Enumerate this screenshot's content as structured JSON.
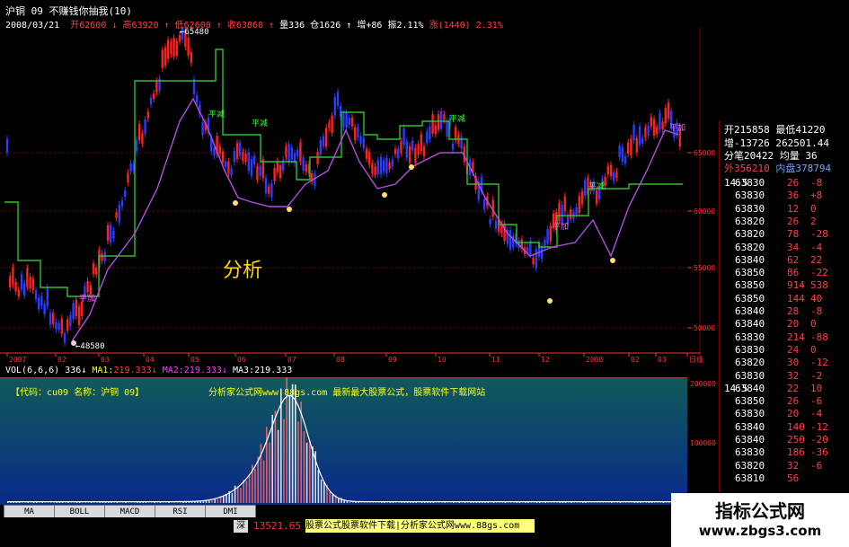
{
  "window": {
    "title": "沪铜 09 不赚钱你抽我(10)"
  },
  "info": {
    "date": "2008/03/21",
    "open_label": "开",
    "open": "62600",
    "high_label": "高",
    "high": "63920",
    "low_label": "低",
    "low": "62600",
    "close_label": "收",
    "close": "63860",
    "volume_label": "量",
    "volume": "336",
    "oi_label": "仓",
    "oi": "1626",
    "add_label": "增",
    "add": "+86",
    "swing_label": "振",
    "swing": "2.11%",
    "rise_label": "涨",
    "rise": "(1440)",
    "rise_pct": "2.31%"
  },
  "price_chart": {
    "high_marker": "65480",
    "low_marker": "48580",
    "big_text": "分析",
    "y_ticks": [
      "65000",
      "60000",
      "55000",
      "50000"
    ],
    "x_ticks": [
      "2007",
      "02",
      "03",
      "04",
      "05",
      "06",
      "07",
      "08",
      "09",
      "10",
      "11",
      "12",
      "2008",
      "02",
      "03",
      "日线"
    ],
    "labels": [
      {
        "text": "平加",
        "kind": "purple"
      },
      {
        "text": "平减",
        "kind": "green"
      },
      {
        "text": "平加",
        "kind": "purple"
      },
      {
        "text": "平减",
        "kind": "green"
      },
      {
        "text": "平加",
        "kind": "purple"
      },
      {
        "text": "平减",
        "kind": "green"
      },
      {
        "text": "平加",
        "kind": "purple"
      }
    ]
  },
  "volume_panel": {
    "label": "VOL(6,6,6)",
    "value": "336",
    "ma1_label": "MA1:",
    "ma1": "219.333",
    "ma2_label": "MA2:",
    "ma2": "219.333",
    "ma3_label": "MA3:",
    "ma3": "219.333",
    "code_line": "【代码：cu09 名称：沪铜  09】",
    "site_line": "分析家公式网www.88gs.com 最新最大股票公式，股票软件下载网站",
    "y_ticks": [
      "200000",
      "100000"
    ]
  },
  "tabs": [
    "MA",
    "BOLL",
    "MACD",
    "RSI",
    "DMI"
  ],
  "status": {
    "market": "深",
    "index": "13521.65",
    "ticker_text": "股票公式股票软件下载|分析家公式网www.88gs.com"
  },
  "right_panel": {
    "header_rows": [
      {
        "a": "开215858",
        "b": "最低41220"
      },
      {
        "a": "增-13726",
        "b": "262501.44"
      },
      {
        "a": "分笔20422",
        "b": "均量    36"
      },
      {
        "a": "外356210",
        "b": "内盘378794"
      }
    ],
    "ticks": [
      {
        "time": "14:5",
        "price": "63830",
        "vol": "26",
        "chg": "-8"
      },
      {
        "time": "",
        "price": "63830",
        "vol": "36",
        "chg": "+8"
      },
      {
        "time": "",
        "price": "63830",
        "vol": "12",
        "chg": "0"
      },
      {
        "time": "",
        "price": "63820",
        "vol": "26",
        "chg": "2"
      },
      {
        "time": "",
        "price": "63820",
        "vol": "78",
        "chg": "-28"
      },
      {
        "time": "",
        "price": "63820",
        "vol": "34",
        "chg": "-4"
      },
      {
        "time": "",
        "price": "63840",
        "vol": "62",
        "chg": "22"
      },
      {
        "time": "",
        "price": "63850",
        "vol": "86",
        "chg": "-22"
      },
      {
        "time": "",
        "price": "63850",
        "vol": "914",
        "chg": "538"
      },
      {
        "time": "",
        "price": "63850",
        "vol": "144",
        "chg": "40"
      },
      {
        "time": "",
        "price": "63840",
        "vol": "28",
        "chg": "-8"
      },
      {
        "time": "",
        "price": "63840",
        "vol": "20",
        "chg": "0"
      },
      {
        "time": "",
        "price": "63830",
        "vol": "214",
        "chg": "-88"
      },
      {
        "time": "",
        "price": "63830",
        "vol": "24",
        "chg": "0"
      },
      {
        "time": "",
        "price": "63820",
        "vol": "30",
        "chg": "-12"
      },
      {
        "time": "",
        "price": "63830",
        "vol": "32",
        "chg": "-2"
      },
      {
        "time": "14:5",
        "price": "63840",
        "vol": "22",
        "chg": "10"
      },
      {
        "time": "",
        "price": "63850",
        "vol": "26",
        "chg": "-6"
      },
      {
        "time": "",
        "price": "63830",
        "vol": "20",
        "chg": "-4"
      },
      {
        "time": "",
        "price": "63840",
        "vol": "140",
        "chg": "-12"
      },
      {
        "time": "",
        "price": "63840",
        "vol": "250",
        "chg": "-20"
      },
      {
        "time": "",
        "price": "63830",
        "vol": "186",
        "chg": "-36"
      },
      {
        "time": "",
        "price": "63820",
        "vol": "32",
        "chg": "-6"
      },
      {
        "time": "",
        "price": "63810",
        "vol": "56",
        "chg": ""
      }
    ]
  },
  "logo": {
    "title": "指标公式网",
    "url": "www.zbgs3.com"
  },
  "colors": {
    "bull": "#ff2020",
    "bear": "#2a3cff",
    "support_line": "#b050e0",
    "resistance_line": "#30c030",
    "grid": "#7a0000",
    "volume_bg_top": "#105a5a",
    "volume_bg_bottom": "#0a2a8a"
  }
}
